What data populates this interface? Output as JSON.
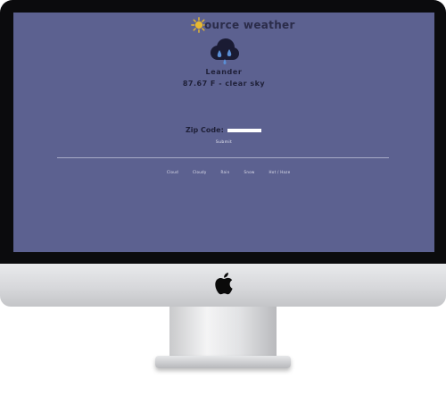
{
  "brand": {
    "name": "ource weather",
    "logo_icon": "sun-icon"
  },
  "weather": {
    "icon": "cloud-rain-icon",
    "city": "Leander",
    "temperature": "87.67 F",
    "separator": "-",
    "description": "clear sky"
  },
  "form": {
    "zip_label": "Zip Code:",
    "zip_value": "",
    "submit_label": "Submit"
  },
  "nav": {
    "items": [
      {
        "label": "Cloud"
      },
      {
        "label": "Cloudy"
      },
      {
        "label": "Rain"
      },
      {
        "label": "Snow"
      },
      {
        "label": "Hot / Haze"
      }
    ]
  },
  "colors": {
    "screen_background": "#5c6190",
    "text_dark": "#1f2038",
    "sun": "#e8b830",
    "cloud": "#1a1b33",
    "rain_drop": "#5a8fd6"
  }
}
